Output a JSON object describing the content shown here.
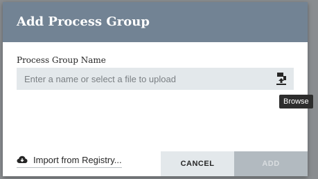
{
  "dialog": {
    "title": "Add Process Group",
    "field_label": "Process Group Name",
    "name_input": {
      "value": "",
      "placeholder": "Enter a name or select a file to upload"
    },
    "browse_icon": "upload-file-icon",
    "tooltip": "Browse",
    "import_icon": "cloud-download-icon",
    "import_label": "Import from Registry...",
    "cancel_label": "CANCEL",
    "add_label": "ADD"
  },
  "colors": {
    "header": "#728394",
    "input_background": "#e3e8eb",
    "add_disabled": "#b2bac0",
    "overlay": "#8a8d90"
  }
}
